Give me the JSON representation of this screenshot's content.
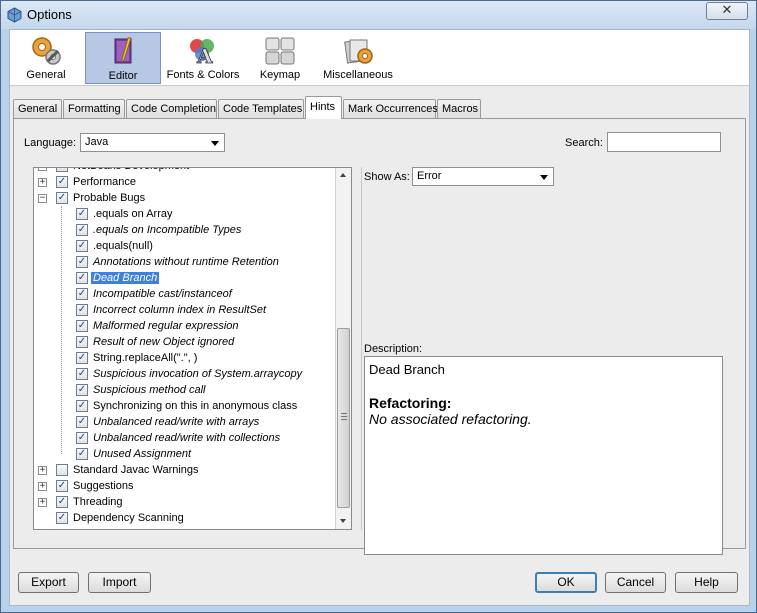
{
  "window": {
    "title": "Options",
    "close_symbol": "✕"
  },
  "categories": [
    {
      "label": "General",
      "icon": "gears-icon",
      "selected": false
    },
    {
      "label": "Editor",
      "icon": "editor-icon",
      "selected": true
    },
    {
      "label": "Fonts & Colors",
      "icon": "fonts-colors-icon",
      "selected": false
    },
    {
      "label": "Keymap",
      "icon": "keymap-icon",
      "selected": false
    },
    {
      "label": "Miscellaneous",
      "icon": "miscellaneous-icon",
      "selected": false
    }
  ],
  "tabs": [
    {
      "label": "General"
    },
    {
      "label": "Formatting"
    },
    {
      "label": "Code Completion"
    },
    {
      "label": "Code Templates"
    },
    {
      "label": "Hints",
      "active": true
    },
    {
      "label": "Mark Occurrences"
    },
    {
      "label": "Macros"
    }
  ],
  "language": {
    "label": "Language:",
    "value": "Java"
  },
  "search": {
    "label": "Search:",
    "value": ""
  },
  "tree": {
    "rows": [
      {
        "label": "NetBeans Development",
        "level": 0,
        "expander": "+",
        "checked": false,
        "italic": false
      },
      {
        "label": "Performance",
        "level": 0,
        "expander": "+",
        "checked": true,
        "italic": false
      },
      {
        "label": "Probable Bugs",
        "level": 0,
        "expander": "−",
        "checked": true,
        "italic": false
      },
      {
        "label": ".equals on Array",
        "level": 1,
        "checked": true,
        "italic": false
      },
      {
        "label": ".equals on Incompatible Types",
        "level": 1,
        "checked": true,
        "italic": true
      },
      {
        "label": ".equals(null)",
        "level": 1,
        "checked": true,
        "italic": false
      },
      {
        "label": "Annotations without runtime Retention",
        "level": 1,
        "checked": true,
        "italic": true
      },
      {
        "label": "Dead Branch",
        "level": 1,
        "checked": true,
        "italic": true,
        "selected": true
      },
      {
        "label": "Incompatible cast/instanceof",
        "level": 1,
        "checked": true,
        "italic": true
      },
      {
        "label": "Incorrect column index in ResultSet",
        "level": 1,
        "checked": true,
        "italic": true
      },
      {
        "label": "Malformed regular expression",
        "level": 1,
        "checked": true,
        "italic": true
      },
      {
        "label": "Result of new Object ignored",
        "level": 1,
        "checked": true,
        "italic": true
      },
      {
        "label": "String.replaceAll(\".\", )",
        "level": 1,
        "checked": true,
        "italic": false
      },
      {
        "label": "Suspicious invocation of System.arraycopy",
        "level": 1,
        "checked": true,
        "italic": true
      },
      {
        "label": "Suspicious method call",
        "level": 1,
        "checked": true,
        "italic": true
      },
      {
        "label": "Synchronizing on this in anonymous class",
        "level": 1,
        "checked": true,
        "italic": false
      },
      {
        "label": "Unbalanced read/write with arrays",
        "level": 1,
        "checked": true,
        "italic": true
      },
      {
        "label": "Unbalanced read/write with collections",
        "level": 1,
        "checked": true,
        "italic": true
      },
      {
        "label": "Unused Assignment",
        "level": 1,
        "checked": true,
        "italic": true
      },
      {
        "label": "Standard Javac Warnings",
        "level": 0,
        "expander": "+",
        "checked": false,
        "italic": false
      },
      {
        "label": "Suggestions",
        "level": 0,
        "expander": "+",
        "checked": true,
        "italic": false
      },
      {
        "label": "Threading",
        "level": 0,
        "expander": "+",
        "checked": true,
        "italic": false
      },
      {
        "label": "Dependency Scanning",
        "level": 0,
        "checked": true,
        "italic": false
      }
    ]
  },
  "show_as": {
    "label": "Show As:",
    "value": "Error"
  },
  "description": {
    "label": "Description:",
    "name": "Dead Branch",
    "refactoring_heading": "Refactoring:",
    "refactoring_text": "No associated refactoring."
  },
  "buttons": {
    "export": "Export",
    "import": "Import",
    "ok": "OK",
    "cancel": "Cancel",
    "help": "Help"
  },
  "check_symbol": "✓"
}
